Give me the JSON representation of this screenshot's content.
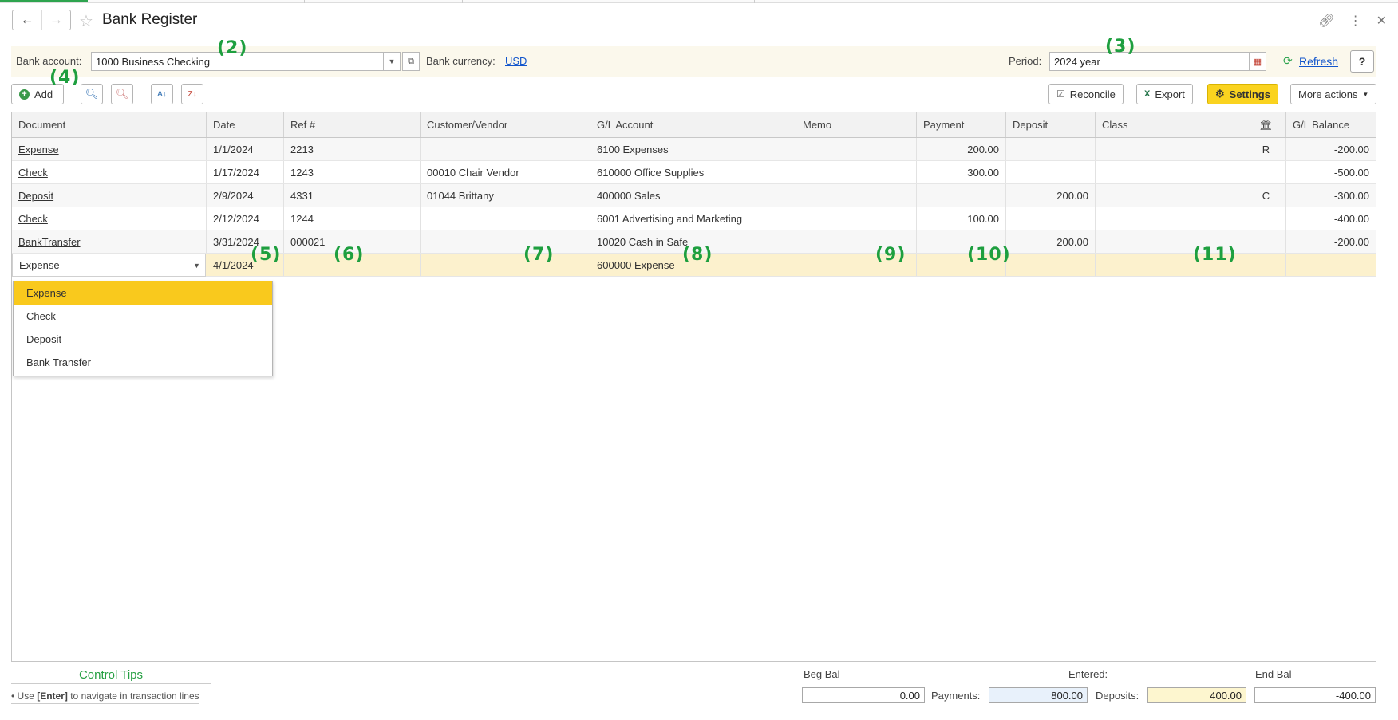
{
  "window": {
    "title": "Bank Register"
  },
  "filters": {
    "bank_account_label": "Bank account:",
    "bank_account_value": "1000 Business Checking",
    "bank_currency_label": "Bank currency:",
    "bank_currency_value": "USD",
    "period_label": "Period:",
    "period_value": "2024 year",
    "refresh_label": "Refresh",
    "help_label": "?"
  },
  "toolbar": {
    "add_label": "Add",
    "reconcile_label": "Reconcile",
    "export_label": "Export",
    "settings_label": "Settings",
    "more_actions_label": "More actions"
  },
  "columns": {
    "document": "Document",
    "date": "Date",
    "ref": "Ref #",
    "customer_vendor": "Customer/Vendor",
    "gl_account": "G/L Account",
    "memo": "Memo",
    "payment": "Payment",
    "deposit": "Deposit",
    "class": "Class",
    "gl_balance": "G/L Balance"
  },
  "rows": [
    {
      "document": "Expense",
      "date": "1/1/2024",
      "ref": "2213",
      "customer_vendor": "",
      "gl_account": "6100 Expenses",
      "memo": "",
      "payment": "200.00",
      "deposit": "",
      "class": "",
      "status": "R",
      "gl_balance": "-200.00"
    },
    {
      "document": "Check",
      "date": "1/17/2024",
      "ref": "1243",
      "customer_vendor": "00010 Chair Vendor",
      "gl_account": "610000 Office Supplies",
      "memo": "",
      "payment": "300.00",
      "deposit": "",
      "class": "",
      "status": "",
      "gl_balance": "-500.00"
    },
    {
      "document": "Deposit",
      "date": "2/9/2024",
      "ref": "4331",
      "customer_vendor": "01044 Brittany",
      "gl_account": "400000 Sales",
      "memo": "",
      "payment": "",
      "deposit": "200.00",
      "class": "",
      "status": "C",
      "gl_balance": "-300.00"
    },
    {
      "document": "Check",
      "date": "2/12/2024",
      "ref": "1244",
      "customer_vendor": "",
      "gl_account": "6001 Advertising and Marketing",
      "memo": "",
      "payment": "100.00",
      "deposit": "",
      "class": "",
      "status": "",
      "gl_balance": "-400.00"
    },
    {
      "document": "BankTransfer",
      "date": "3/31/2024",
      "ref": "000021",
      "customer_vendor": "",
      "gl_account": "10020 Cash in Safe",
      "memo": "",
      "payment": "",
      "deposit": "200.00",
      "class": "",
      "status": "",
      "gl_balance": "-200.00"
    }
  ],
  "edit_row": {
    "document": "Expense",
    "date": "4/1/2024",
    "gl_account": "600000 Expense"
  },
  "document_dropdown": [
    "Expense",
    "Check",
    "Deposit",
    "Bank Transfer"
  ],
  "markers": [
    "(2)",
    "(3)",
    "(4)",
    "(5)",
    "(6)",
    "(7)",
    "(8)",
    "(9)",
    "(10)",
    "(11)"
  ],
  "control_tips": {
    "title": "Control Tips",
    "prefix": "• Use ",
    "key": "[Enter]",
    "suffix": " to navigate in transaction lines"
  },
  "totals": {
    "beg_bal_label": "Beg Bal",
    "beg_bal_value": "0.00",
    "entered_label": "Entered:",
    "payments_label": "Payments:",
    "payments_value": "800.00",
    "deposits_label": "Deposits:",
    "deposits_value": "400.00",
    "end_bal_label": "End Bal",
    "end_bal_value": "-400.00"
  },
  "colors": {
    "accent_yellow": "#fad31f",
    "marker_green": "#1e9f3f",
    "link_blue": "#1155cc"
  }
}
